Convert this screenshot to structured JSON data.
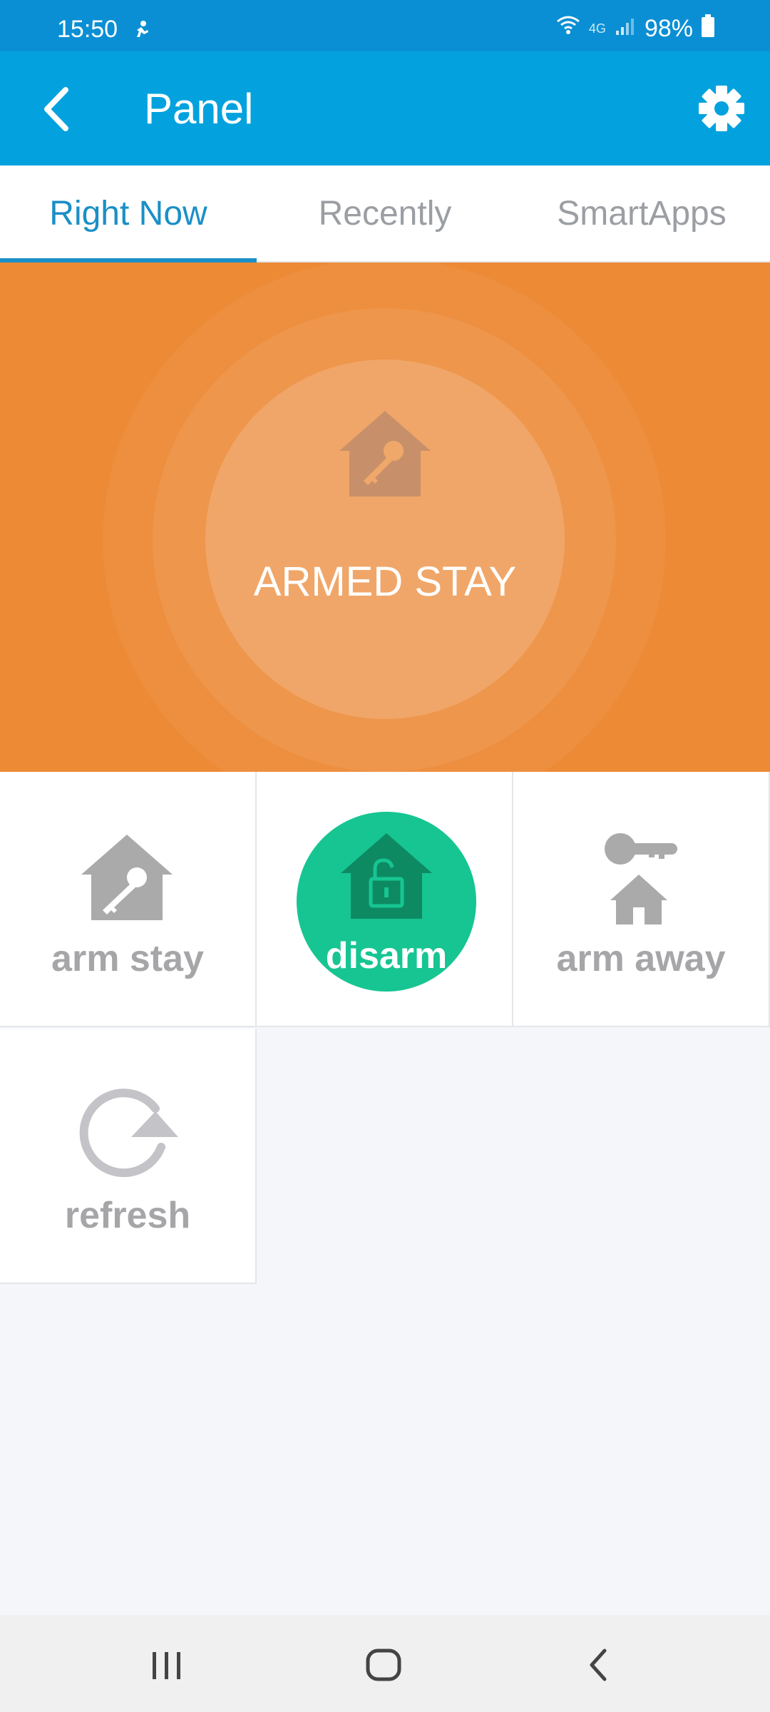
{
  "status_bar": {
    "time": "15:50",
    "network": "4G",
    "battery": "98%"
  },
  "app_bar": {
    "title": "Panel",
    "back_icon": "chevron-left-icon",
    "settings_icon": "gear-icon"
  },
  "tabs": [
    {
      "label": "Right Now",
      "active": true
    },
    {
      "label": "Recently",
      "active": false
    },
    {
      "label": "SmartApps",
      "active": false
    }
  ],
  "status_panel": {
    "state": "ARMED STAY",
    "icon": "house-key-icon",
    "color": "#ec8a35"
  },
  "actions": [
    {
      "label": "arm stay",
      "icon": "house-key-icon",
      "selected": false
    },
    {
      "label": "disarm",
      "icon": "house-unlock-icon",
      "selected": true,
      "color": "#16c592"
    },
    {
      "label": "arm away",
      "icon": "key-house-icon",
      "selected": false
    },
    {
      "label": "refresh",
      "icon": "refresh-icon",
      "selected": false
    }
  ],
  "accent_colors": {
    "app_bar": "#03a2de",
    "status_bar": "#0a8fd4",
    "active_tab": "#1b8fc7"
  }
}
